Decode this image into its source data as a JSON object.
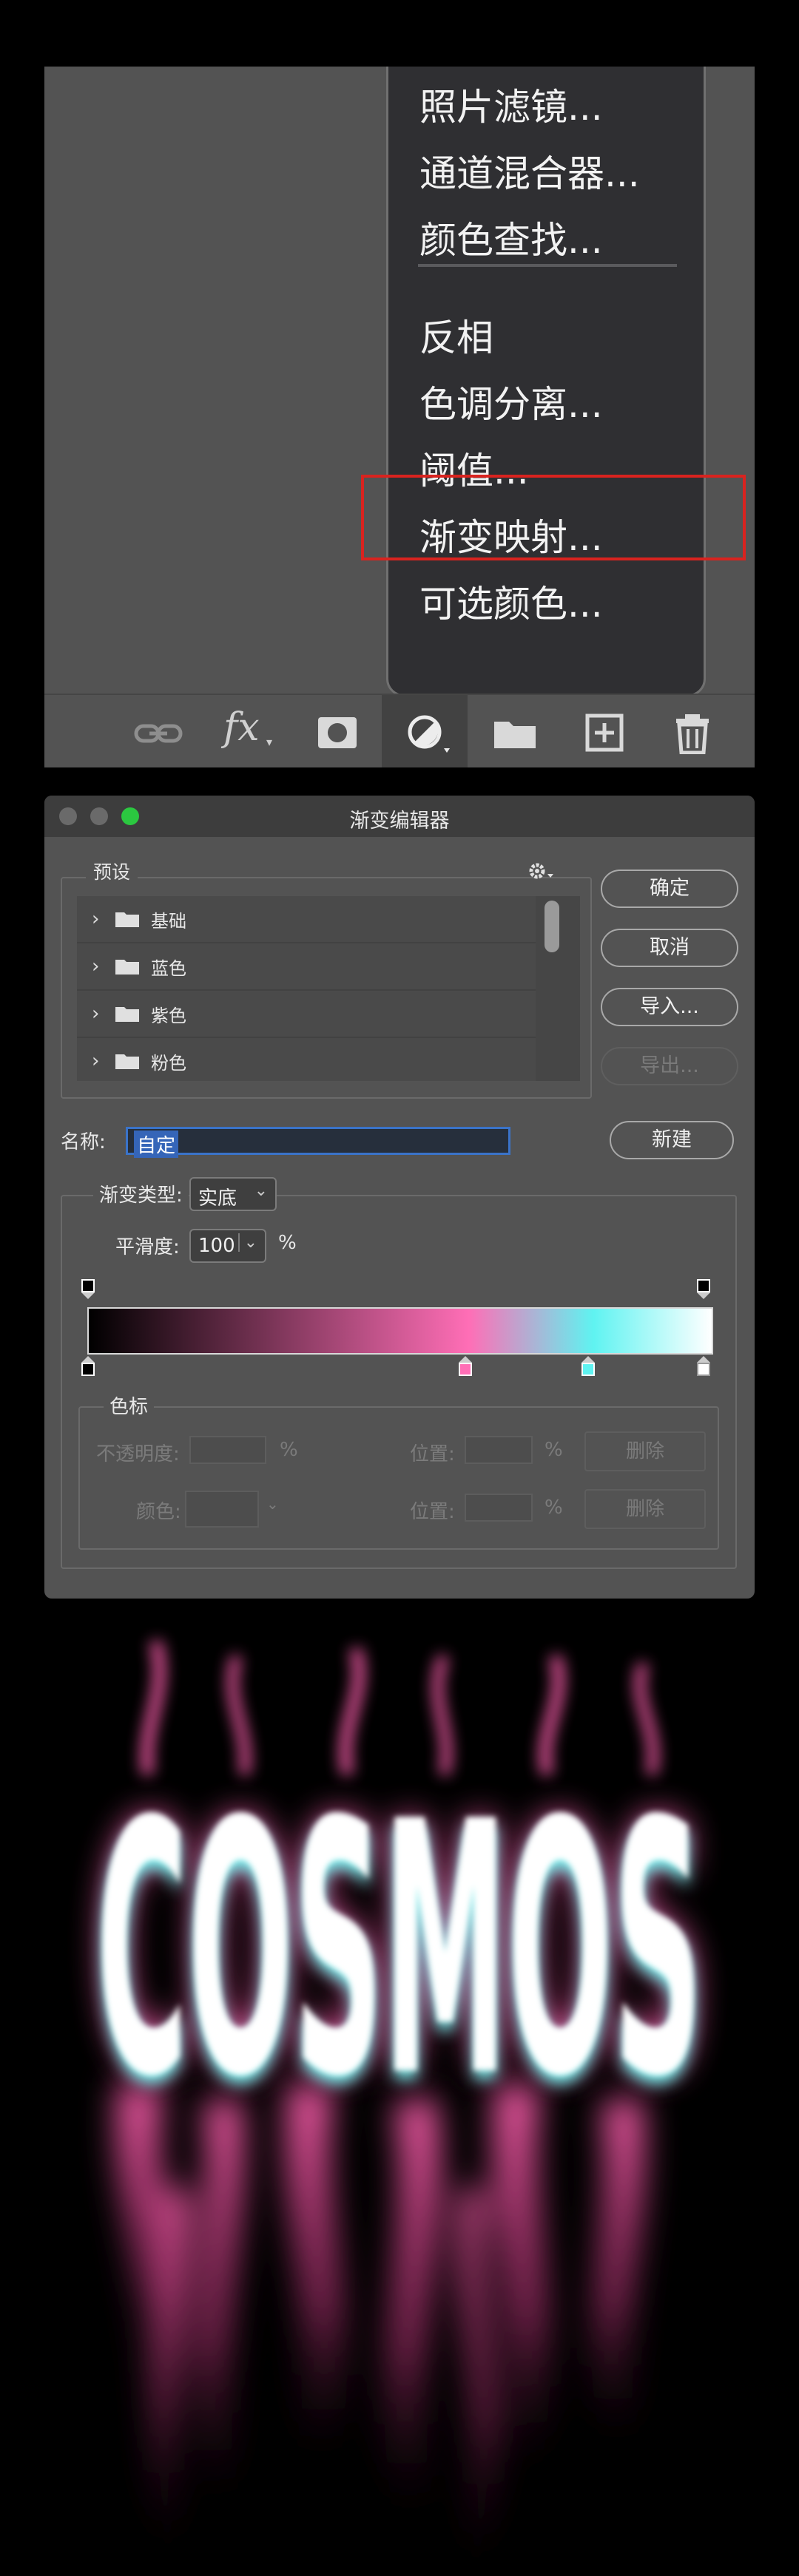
{
  "menu": {
    "items": [
      "照片滤镜...",
      "通道混合器...",
      "颜色查找...",
      "反相",
      "色调分离...",
      "阈值...",
      "渐变映射...",
      "可选颜色..."
    ],
    "highlighted": "渐变映射..."
  },
  "layers_toolbar": {
    "icons": [
      "link-icon",
      "fx-icon",
      "mask-icon",
      "adjustment-icon",
      "folder-icon",
      "new-layer-icon",
      "trash-icon"
    ],
    "fx_label": "fx"
  },
  "gradient_editor": {
    "title": "渐变编辑器",
    "presets_label": "预设",
    "presets": [
      "基础",
      "蓝色",
      "紫色",
      "粉色"
    ],
    "buttons": {
      "ok": "确定",
      "cancel": "取消",
      "import": "导入...",
      "export": "导出...",
      "new": "新建"
    },
    "name_label": "名称:",
    "name_value": "自定",
    "gradient_type_label": "渐变类型:",
    "gradient_type_value": "实底",
    "smoothness_label": "平滑度:",
    "smoothness_value": "100",
    "percent": "%",
    "gradient_colors": [
      "#000000",
      "#ff6eb6",
      "#5ff3f1",
      "#ffffff"
    ],
    "color_stop_positions": [
      0,
      61,
      81,
      100
    ],
    "stops_group_label": "色标",
    "opacity_label": "不透明度:",
    "color_label": "颜色:",
    "position_label": "位置:",
    "delete_label": "删除"
  },
  "artwork": {
    "text": "COSMOS",
    "glow_colors": {
      "pink": "#ff5fae",
      "cyan": "#6ff7f2",
      "core": "#ffffff"
    }
  }
}
